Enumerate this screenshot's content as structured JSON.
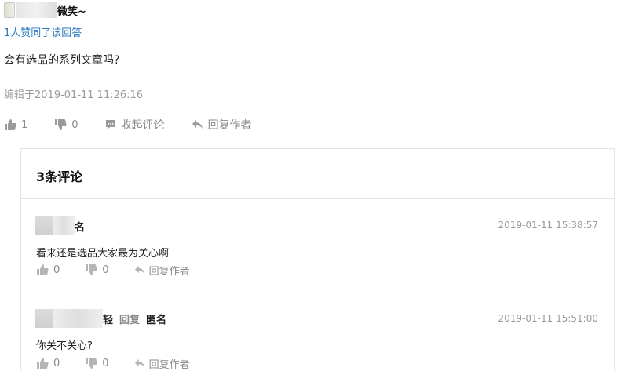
{
  "answer": {
    "author_suffix": "微笑~",
    "agree_text": "1人赞同了该回答",
    "content": "会有选品的系列文章吗?",
    "edit_time": "编辑于2019-01-11 11:26:16",
    "actions": {
      "upvotes": "1",
      "downvotes": "0",
      "collapse_label": "收起评论",
      "reply_label": "回复作者"
    }
  },
  "comments": {
    "title": "3条评论",
    "items": [
      {
        "author_suffix": "名",
        "time": "2019-01-11 15:38:57",
        "text": "看来还是选品大家最为关心啊",
        "upvotes": "0",
        "downvotes": "0",
        "reply_label": "回复作者"
      },
      {
        "author_suffix": "轻",
        "reply_word": "回复",
        "reply_target": "匿名",
        "time": "2019-01-11 15:51:00",
        "text": "你关不关心?",
        "upvotes": "0",
        "downvotes": "0",
        "reply_label": "回复作者"
      }
    ]
  },
  "icons": {
    "thumb_up": "thumb-up-icon",
    "thumb_down": "thumb-down-icon",
    "comment": "comment-icon",
    "reply": "reply-arrow-icon"
  },
  "colors": {
    "link_blue": "#2a78c2",
    "muted_gray": "#8a8a8a",
    "border": "#e4e4e4"
  }
}
